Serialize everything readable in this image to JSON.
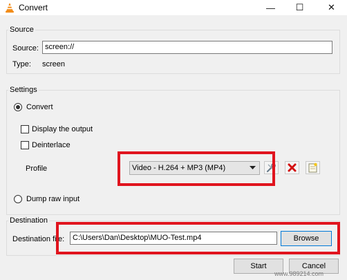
{
  "window": {
    "title": "Convert",
    "minimize": "—",
    "maximize": "☐",
    "close": "✕"
  },
  "source": {
    "group_label": "Source",
    "source_label": "Source:",
    "source_value": "screen://",
    "type_label": "Type:",
    "type_value": "screen"
  },
  "settings": {
    "group_label": "Settings",
    "convert_label": "Convert",
    "display_output_label": "Display the output",
    "deinterlace_label": "Deinterlace",
    "profile_label": "Profile",
    "profile_value": "Video - H.264 + MP3 (MP4)",
    "dump_label": "Dump raw input"
  },
  "destination": {
    "group_label": "Destination",
    "file_label": "Destination file:",
    "file_value": "C:\\Users\\Dan\\Desktop\\MUO-Test.mp4",
    "browse_label": "Browse"
  },
  "footer": {
    "start_label": "Start",
    "cancel_label": "Cancel"
  },
  "watermark": "www.989214.com",
  "colors": {
    "highlight_red": "#e0141e",
    "window_bg": "#f0f0f0"
  },
  "icons": [
    "vlc-cone-icon",
    "edit-profile-icon",
    "delete-profile-icon",
    "new-profile-icon",
    "dropdown-arrow-icon"
  ]
}
